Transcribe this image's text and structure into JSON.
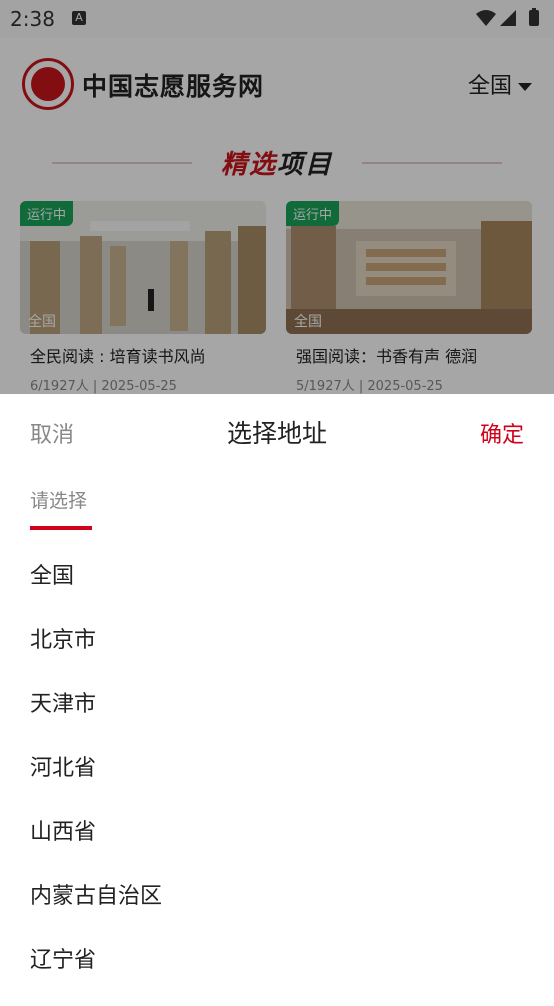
{
  "status_bar": {
    "time": "2:38",
    "notification_icon": "A"
  },
  "header": {
    "site_title": "中国志愿服务网",
    "region_selector": {
      "label": "全国",
      "icon": "caret-down-icon"
    }
  },
  "section": {
    "title_red": "精选",
    "title_dark": "项目"
  },
  "cards": [
    {
      "status": "运行中",
      "region": "全国",
      "title": "全民阅读 : 培育读书风尚",
      "meta": "6/1927人  |  2025-05-25"
    },
    {
      "status": "运行中",
      "region": "全国",
      "title": "强国阅读：书香有声 德润",
      "meta": "5/1927人  |  2025-05-25"
    }
  ],
  "picker": {
    "cancel_label": "取消",
    "title": "选择地址",
    "confirm_label": "确定",
    "tab_label": "请选择",
    "options": [
      "全国",
      "北京市",
      "天津市",
      "河北省",
      "山西省",
      "内蒙古自治区",
      "辽宁省"
    ]
  },
  "colors": {
    "accent": "#d0021b",
    "status_green": "#19a35a"
  }
}
